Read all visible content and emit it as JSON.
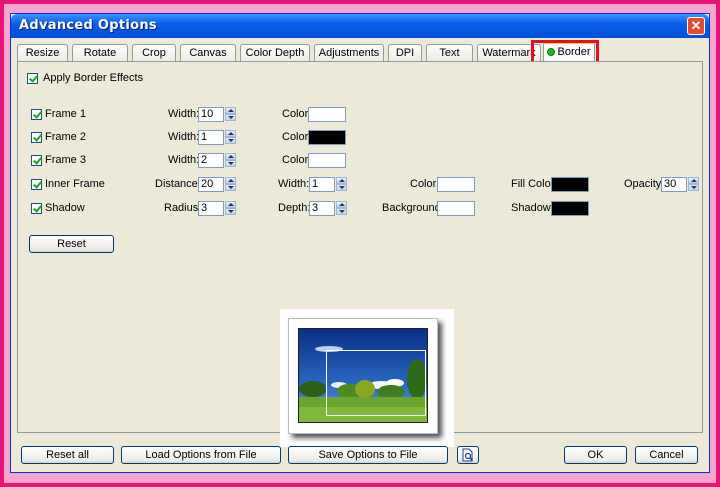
{
  "window": {
    "title": "Advanced Options",
    "close": "✕"
  },
  "tabs": [
    "Resize",
    "Rotate",
    "Crop",
    "Canvas",
    "Color Depth",
    "Adjustments",
    "DPI",
    "Text",
    "Watermark",
    "Border"
  ],
  "active_tab": "Border",
  "apply_border_effects": {
    "label": "Apply Border Effects",
    "checked": true
  },
  "frame1": {
    "label": "Frame 1",
    "checked": true,
    "width_label": "Width:",
    "width": "10",
    "color_label": "Color:",
    "color": "#ffffff"
  },
  "frame2": {
    "label": "Frame 2",
    "checked": true,
    "width_label": "Width:",
    "width": "1",
    "color_label": "Color:",
    "color": "#000000"
  },
  "frame3": {
    "label": "Frame 3",
    "checked": true,
    "width_label": "Width:",
    "width": "2",
    "color_label": "Color:",
    "color": "#ffffff"
  },
  "inner_frame": {
    "label": "Inner Frame",
    "checked": true,
    "distance_label": "Distance:",
    "distance": "20",
    "width_label": "Width:",
    "width": "1",
    "color_label": "Color:",
    "color": "#ffffff",
    "fill_color_label": "Fill Color:",
    "fill_color": "#000000",
    "opacity_label": "Opacity:",
    "opacity": "30"
  },
  "shadow": {
    "label": "Shadow",
    "checked": true,
    "radius_label": "Radius:",
    "radius": "3",
    "depth_label": "Depth:",
    "depth": "3",
    "background_label": "Background:",
    "background": "#ffffff",
    "shadow_label": "Shadow:",
    "shadow_color": "#000000"
  },
  "reset_label": "Reset",
  "footer": {
    "reset_all": "Reset all",
    "load_options": "Load Options from File",
    "save_options": "Save Options to File",
    "ok": "OK",
    "cancel": "Cancel"
  }
}
